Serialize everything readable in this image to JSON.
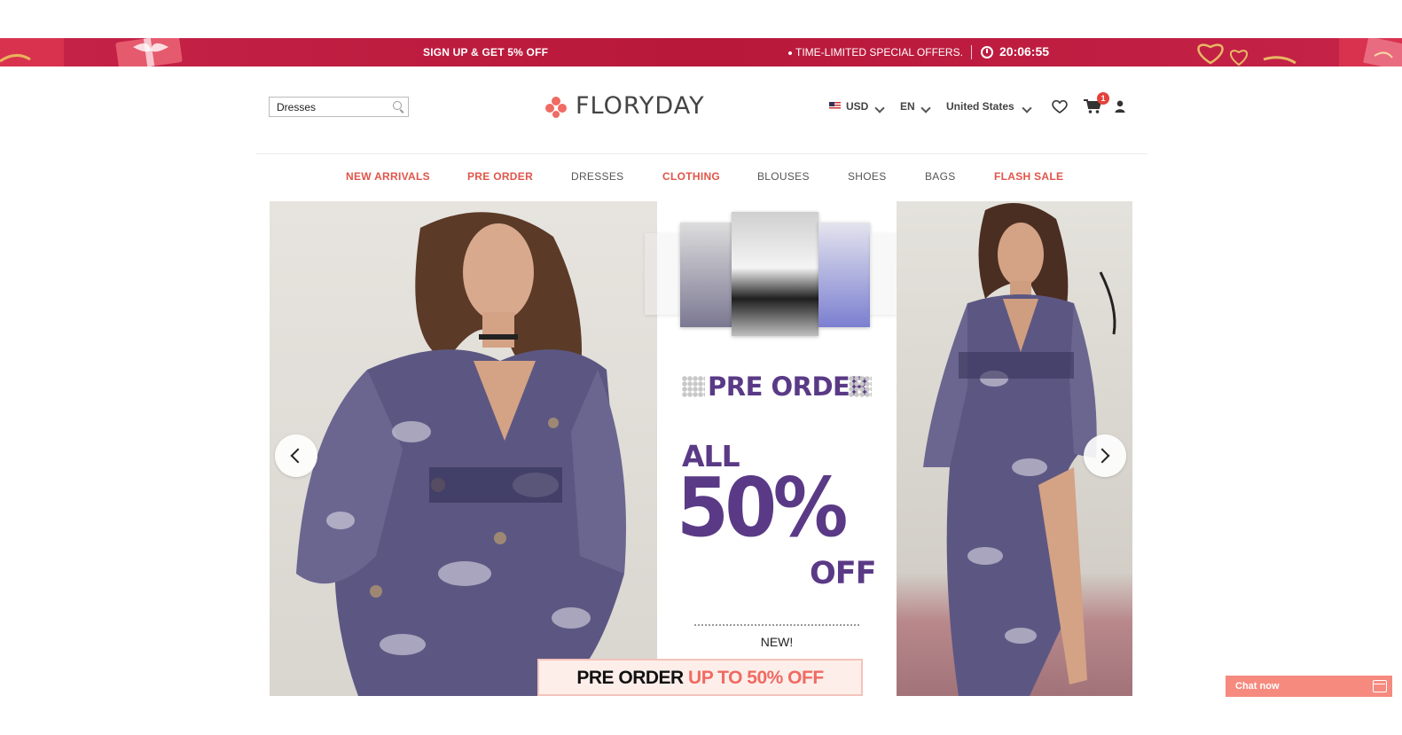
{
  "promo_bar": {
    "signup": "SIGN UP & GET 5% OFF",
    "offers": "TIME-LIMITED SPECIAL OFFERS.",
    "countdown": "20:06:55",
    "bg_color": "#b81b3b"
  },
  "header": {
    "search": {
      "value": "Dresses",
      "icon": "search-icon"
    },
    "logo_text": "FLORYDAY",
    "currency": "USD",
    "language": "EN",
    "country": "United States",
    "cart_count": "1",
    "icons": [
      "flag-icon",
      "heart-icon",
      "cart-icon",
      "user-icon"
    ]
  },
  "nav": {
    "items": [
      {
        "label": "NEW ARRIVALS",
        "highlight": true
      },
      {
        "label": "PRE ORDER",
        "highlight": true
      },
      {
        "label": "DRESSES",
        "highlight": false
      },
      {
        "label": "CLOTHING",
        "highlight": true
      },
      {
        "label": "BLOUSES",
        "highlight": false
      },
      {
        "label": "SHOES",
        "highlight": false
      },
      {
        "label": "BAGS",
        "highlight": false
      },
      {
        "label": "FLASH SALE",
        "highlight": true
      }
    ],
    "accent_color": "#e0554a"
  },
  "banner": {
    "title": "PRE ORDER",
    "all": "ALL",
    "percent": "50%",
    "off": "OFF",
    "new": "NEW!",
    "strip_dark": "PRE ORDER",
    "strip_highlight": "UP TO 50% OFF",
    "promo_color": "#5a3a86"
  },
  "chat": {
    "label": "Chat now"
  }
}
